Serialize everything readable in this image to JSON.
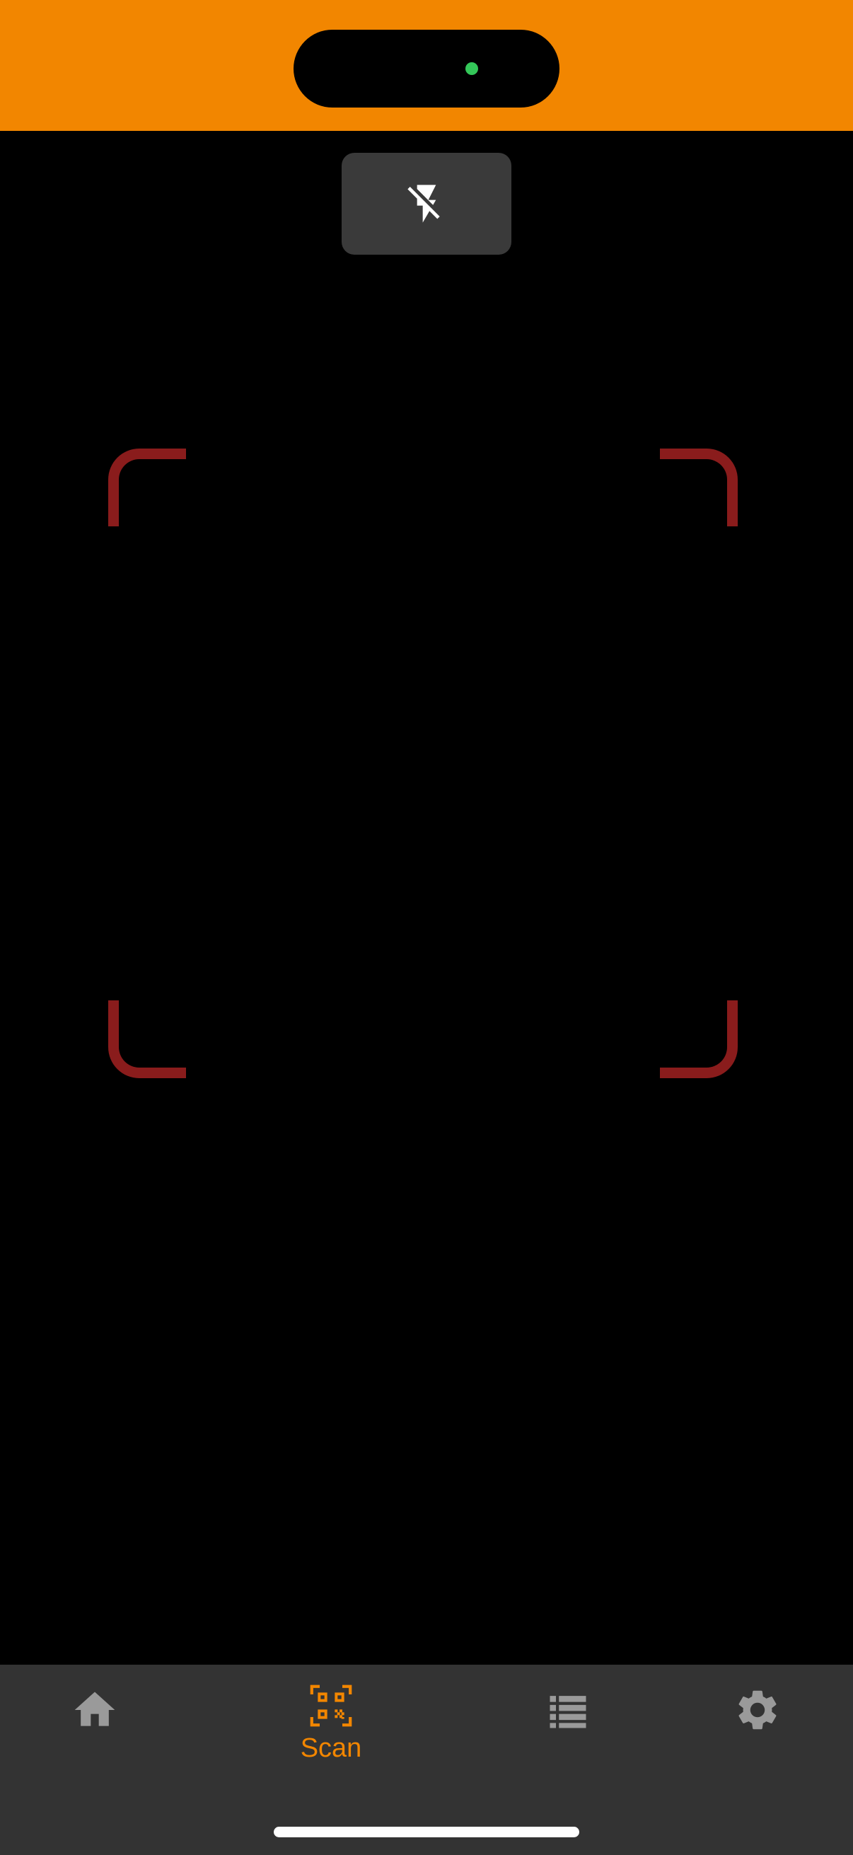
{
  "colors": {
    "status_bar_bg": "#f28600",
    "accent": "#f28600",
    "camera_dot": "#34c759",
    "viewfinder_corner": "#8a1c1c",
    "tab_inactive": "#9a9a9a",
    "flash_icon": "#ffffff"
  },
  "toolbar": {
    "flash_icon": "flash-off-icon"
  },
  "tabs": [
    {
      "id": "home",
      "icon": "home-icon",
      "label": ""
    },
    {
      "id": "scan",
      "icon": "qr-scan-icon",
      "label": "Scan",
      "selected": true
    },
    {
      "id": "history",
      "icon": "list-icon",
      "label": ""
    },
    {
      "id": "settings",
      "icon": "gear-icon",
      "label": ""
    }
  ]
}
